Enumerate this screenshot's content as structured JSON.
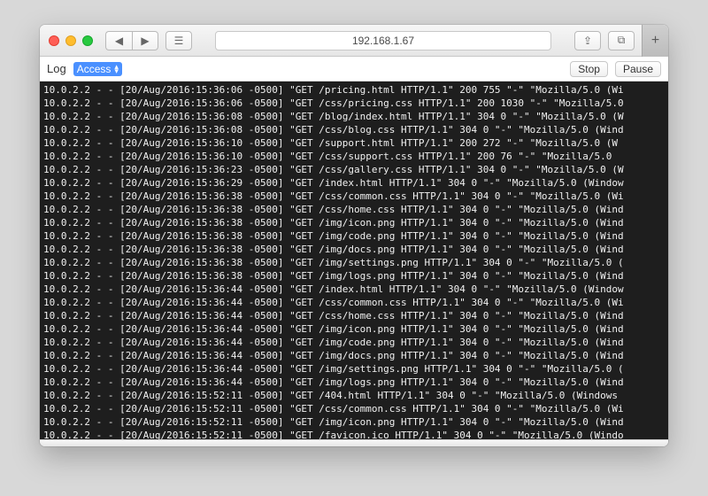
{
  "titlebar": {
    "url": "192.168.1.67"
  },
  "toolbar": {
    "label": "Log",
    "select_value": "Access",
    "stop": "Stop",
    "pause": "Pause"
  },
  "log_lines": [
    "10.0.2.2 - - [20/Aug/2016:15:36:06 -0500] \"GET /pricing.html HTTP/1.1\" 200 755 \"-\" \"Mozilla/5.0 (Wi",
    "10.0.2.2 - - [20/Aug/2016:15:36:06 -0500] \"GET /css/pricing.css HTTP/1.1\" 200 1030 \"-\" \"Mozilla/5.0",
    "10.0.2.2 - - [20/Aug/2016:15:36:08 -0500] \"GET /blog/index.html HTTP/1.1\" 304 0 \"-\" \"Mozilla/5.0 (W",
    "10.0.2.2 - - [20/Aug/2016:15:36:08 -0500] \"GET /css/blog.css HTTP/1.1\" 304 0 \"-\" \"Mozilla/5.0 (Wind",
    "10.0.2.2 - - [20/Aug/2016:15:36:10 -0500] \"GET /support.html HTTP/1.1\" 200 272 \"-\" \"Mozilla/5.0 (W",
    "10.0.2.2 - - [20/Aug/2016:15:36:10 -0500] \"GET /css/support.css HTTP/1.1\" 200 76 \"-\" \"Mozilla/5.0",
    "10.0.2.2 - - [20/Aug/2016:15:36:23 -0500] \"GET /css/gallery.css HTTP/1.1\" 304 0 \"-\" \"Mozilla/5.0 (W",
    "10.0.2.2 - - [20/Aug/2016:15:36:29 -0500] \"GET /index.html HTTP/1.1\" 304 0 \"-\" \"Mozilla/5.0 (Window",
    "10.0.2.2 - - [20/Aug/2016:15:36:38 -0500] \"GET /css/common.css HTTP/1.1\" 304 0 \"-\" \"Mozilla/5.0 (Wi",
    "10.0.2.2 - - [20/Aug/2016:15:36:38 -0500] \"GET /css/home.css HTTP/1.1\" 304 0 \"-\" \"Mozilla/5.0 (Wind",
    "10.0.2.2 - - [20/Aug/2016:15:36:38 -0500] \"GET /img/icon.png HTTP/1.1\" 304 0 \"-\" \"Mozilla/5.0 (Wind",
    "10.0.2.2 - - [20/Aug/2016:15:36:38 -0500] \"GET /img/code.png HTTP/1.1\" 304 0 \"-\" \"Mozilla/5.0 (Wind",
    "10.0.2.2 - - [20/Aug/2016:15:36:38 -0500] \"GET /img/docs.png HTTP/1.1\" 304 0 \"-\" \"Mozilla/5.0 (Wind",
    "10.0.2.2 - - [20/Aug/2016:15:36:38 -0500] \"GET /img/settings.png HTTP/1.1\" 304 0 \"-\" \"Mozilla/5.0 (",
    "10.0.2.2 - - [20/Aug/2016:15:36:38 -0500] \"GET /img/logs.png HTTP/1.1\" 304 0 \"-\" \"Mozilla/5.0 (Wind",
    "10.0.2.2 - - [20/Aug/2016:15:36:44 -0500] \"GET /index.html HTTP/1.1\" 304 0 \"-\" \"Mozilla/5.0 (Window",
    "10.0.2.2 - - [20/Aug/2016:15:36:44 -0500] \"GET /css/common.css HTTP/1.1\" 304 0 \"-\" \"Mozilla/5.0 (Wi",
    "10.0.2.2 - - [20/Aug/2016:15:36:44 -0500] \"GET /css/home.css HTTP/1.1\" 304 0 \"-\" \"Mozilla/5.0 (Wind",
    "10.0.2.2 - - [20/Aug/2016:15:36:44 -0500] \"GET /img/icon.png HTTP/1.1\" 304 0 \"-\" \"Mozilla/5.0 (Wind",
    "10.0.2.2 - - [20/Aug/2016:15:36:44 -0500] \"GET /img/code.png HTTP/1.1\" 304 0 \"-\" \"Mozilla/5.0 (Wind",
    "10.0.2.2 - - [20/Aug/2016:15:36:44 -0500] \"GET /img/docs.png HTTP/1.1\" 304 0 \"-\" \"Mozilla/5.0 (Wind",
    "10.0.2.2 - - [20/Aug/2016:15:36:44 -0500] \"GET /img/settings.png HTTP/1.1\" 304 0 \"-\" \"Mozilla/5.0 (",
    "10.0.2.2 - - [20/Aug/2016:15:36:44 -0500] \"GET /img/logs.png HTTP/1.1\" 304 0 \"-\" \"Mozilla/5.0 (Wind",
    "10.0.2.2 - - [20/Aug/2016:15:52:11 -0500] \"GET /404.html HTTP/1.1\" 304 0 \"-\" \"Mozilla/5.0 (Windows",
    "10.0.2.2 - - [20/Aug/2016:15:52:11 -0500] \"GET /css/common.css HTTP/1.1\" 304 0 \"-\" \"Mozilla/5.0 (Wi",
    "10.0.2.2 - - [20/Aug/2016:15:52:11 -0500] \"GET /img/icon.png HTTP/1.1\" 304 0 \"-\" \"Mozilla/5.0 (Wind",
    "10.0.2.2 - - [20/Aug/2016:15:52:11 -0500] \"GET /favicon.ico HTTP/1.1\" 304 0 \"-\" \"Mozilla/5.0 (Windo"
  ]
}
